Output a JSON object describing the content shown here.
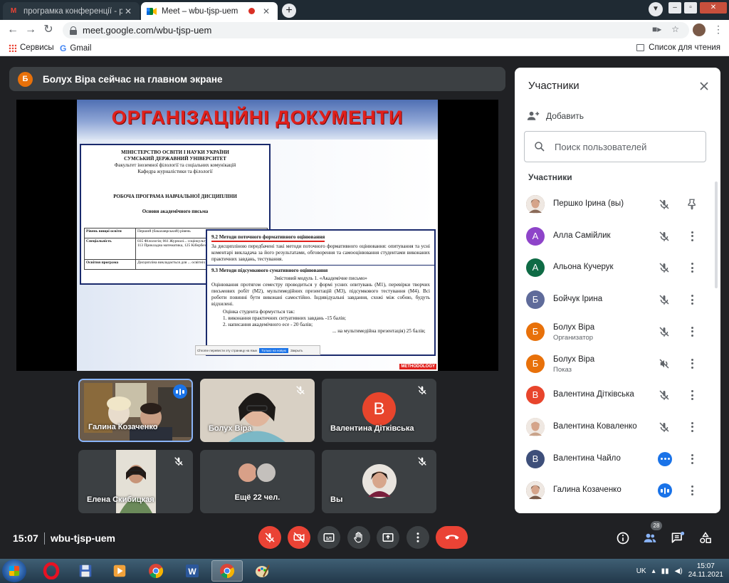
{
  "browser": {
    "tabs": [
      {
        "title": "програмка конференції - pershk",
        "active": false,
        "favicon": "gmail-icon"
      },
      {
        "title": "Meet – wbu-tjsp-uem",
        "active": true,
        "favicon": "meet-icon",
        "recording": true
      }
    ],
    "url": "meet.google.com/wbu-tjsp-uem",
    "bookmarks": {
      "apps": "Сервисы",
      "gmail": "Gmail",
      "reading_list": "Список для чтения"
    }
  },
  "meet": {
    "banner": {
      "avatar_letter": "Б",
      "text": "Болух Віра сейчас на главном экране",
      "avatar_color": "#e8710a"
    },
    "slide": {
      "title": "ОРГАНІЗАЦІЙНІ ДОКУМЕНТИ",
      "doc1": {
        "ministry": "МІНІСТЕРСТВО ОСВІТИ І НАУКИ УКРАЇНИ",
        "university": "СУМСЬКИЙ ДЕРЖАВНИЙ УНІВЕРСИТЕТ",
        "faculty": "Факультет іноземної філології та соціальних комунікацій",
        "department": "Кафедра журналістики та філології",
        "program": "РОБОЧА ПРОГРАМА НАВЧАЛЬНОЇ ДИСЦИПЛІНИ",
        "course": "Основи академічного письма",
        "rows": [
          {
            "label": "Рівень вищої освіти",
            "value": "Перший (бакалаврський) рівень"
          },
          {
            "label": "Спеціальність",
            "value": "035 Філологія; 061 Журналі... соціокультурних діяльності; 053 ... роботи, 113 Прикладна математика, 125 Кібербезпека"
          },
          {
            "label": "Освітня програма",
            "value": "Дисципліна викладається для ... освітніх спеціальностей"
          }
        ]
      },
      "doc2": {
        "h1": "9.2 Методи поточного формативного оцінювання",
        "p1": "За дисципліною передбачені такі методи поточного формативного оцінювання: опитування та усні коментарі викладача за його результатами, обговорення та самооцінювання студентами виконаних практичних завдань, тестування.",
        "h2": "9.3 Методи підсумкового сумативного оцінювання",
        "module": "Змістовий модуль 1. «Академічне письмо»",
        "p2": "Оцінювання протягом семестру проводиться у формі усних опитувань (М1), перевірки творчих письмових робіт (М2), мультимедійних презентацій (М3), підсумкового тестування (М4). Всі роботи повинні бути виконані самостійно. Індивідуальні завдання, схожі між собою, будуть відхилені.",
        "l0": "Оцінка студента формується так:",
        "l1": "1. виконання практичних ситуативних завдань -15 балів;",
        "l2": "2. написання академічного есе - 20 балів;",
        "l3": "... на мультимедійна презентація) 25 балів;"
      },
      "translate_bar": {
        "text": "Chrome перевести эту страницу на язык",
        "button": "Только на новую",
        "link": "Закрыть"
      },
      "watermark": "METHODOLOGY"
    },
    "tiles": [
      {
        "name": "Галина Козаченко",
        "state": "speaking"
      },
      {
        "name": "Болух Віра",
        "state": "muted"
      },
      {
        "name": "Валентина Дітківська",
        "state": "muted",
        "avatar_letter": "В",
        "avatar_color": "#e8452c"
      },
      {
        "name": "Елена Скибицкая",
        "state": "muted"
      },
      {
        "name": "Ещё 22 чел.",
        "state": "more"
      },
      {
        "name": "Вы",
        "state": "muted"
      }
    ],
    "bottom": {
      "time": "15:07",
      "meeting_code": "wbu-tjsp-uem",
      "participant_count": "28"
    },
    "controls": [
      "mic-off",
      "camera-off",
      "captions",
      "raise-hand",
      "present",
      "more",
      "hang-up"
    ]
  },
  "panel": {
    "title": "Участники",
    "add_label": "Добавить",
    "search_placeholder": "Поиск пользователей",
    "section_label": "Участники",
    "participants": [
      {
        "name": "Першко Ірина (вы)",
        "avatar": "photo",
        "color": "#8a6a58",
        "action": "pin",
        "mic": "muted"
      },
      {
        "name": "Алла Самійлик",
        "avatar": "А",
        "color": "#8e44c9",
        "mic": "muted"
      },
      {
        "name": "Альона Кучерук",
        "avatar": "А",
        "color": "#0f6b45",
        "mic": "muted"
      },
      {
        "name": "Бойчук Ірина",
        "avatar": "Б",
        "color": "#5f6b9a",
        "mic": "muted"
      },
      {
        "name": "Болух Віра",
        "role": "Организатор",
        "avatar": "Б",
        "color": "#e8710a",
        "mic": "muted"
      },
      {
        "name": "Болух Віра",
        "role": "Показ",
        "avatar": "Б",
        "color": "#e8710a",
        "mic": "presenting"
      },
      {
        "name": "Валентина Дітківська",
        "avatar": "В",
        "color": "#e8452c",
        "mic": "muted"
      },
      {
        "name": "Валентина Коваленко",
        "avatar": "photo",
        "color": "#c9a38a",
        "mic": "muted"
      },
      {
        "name": "Валентина Чайло",
        "avatar": "В",
        "color": "#3e4f7a",
        "mic": "dots"
      },
      {
        "name": "Галина Козаченко",
        "avatar": "photo",
        "color": "#7a5a48",
        "mic": "speaking"
      }
    ]
  },
  "taskbar": {
    "apps": [
      "opera-icon",
      "save-icon",
      "media-player-icon",
      "chrome-icon",
      "word-icon",
      "chrome-active-icon",
      "paint-icon"
    ],
    "lang": "UK",
    "time": "15:07",
    "date": "24.11.2021"
  }
}
